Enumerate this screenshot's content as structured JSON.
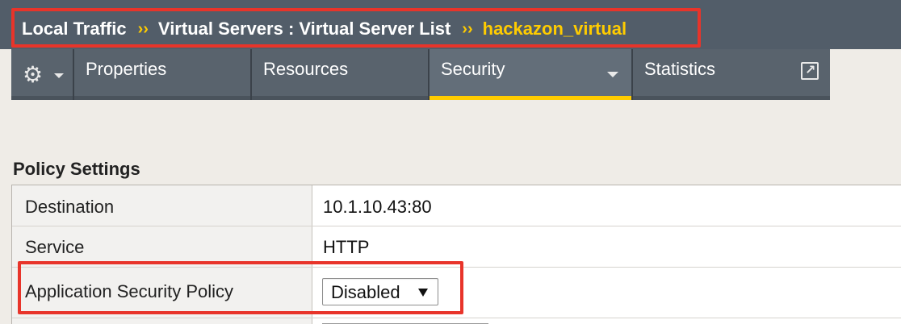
{
  "breadcrumb": {
    "items": [
      "Local Traffic",
      "Virtual Servers : Virtual Server List"
    ],
    "separator": "››",
    "current": "hackazon_virtual"
  },
  "tabs": [
    {
      "id": "gear",
      "icon": "gear-icon"
    },
    {
      "id": "properties",
      "label": "Properties"
    },
    {
      "id": "resources",
      "label": "Resources"
    },
    {
      "id": "security",
      "label": "Security",
      "active": true
    },
    {
      "id": "statistics",
      "label": "Statistics",
      "icon": "external-link-icon"
    }
  ],
  "section": {
    "title": "Policy Settings"
  },
  "settings": {
    "destination": {
      "label": "Destination",
      "value": "10.1.10.43:80"
    },
    "service": {
      "label": "Service",
      "value": "HTTP"
    },
    "asm_policy": {
      "label": "Application Security Policy",
      "selected": "Disabled"
    }
  },
  "colors": {
    "header_bg": "#525d69",
    "accent": "#ffcc00",
    "highlight": "#e8342a",
    "tab_bg": "#59636d",
    "page_bg": "#efece7"
  }
}
